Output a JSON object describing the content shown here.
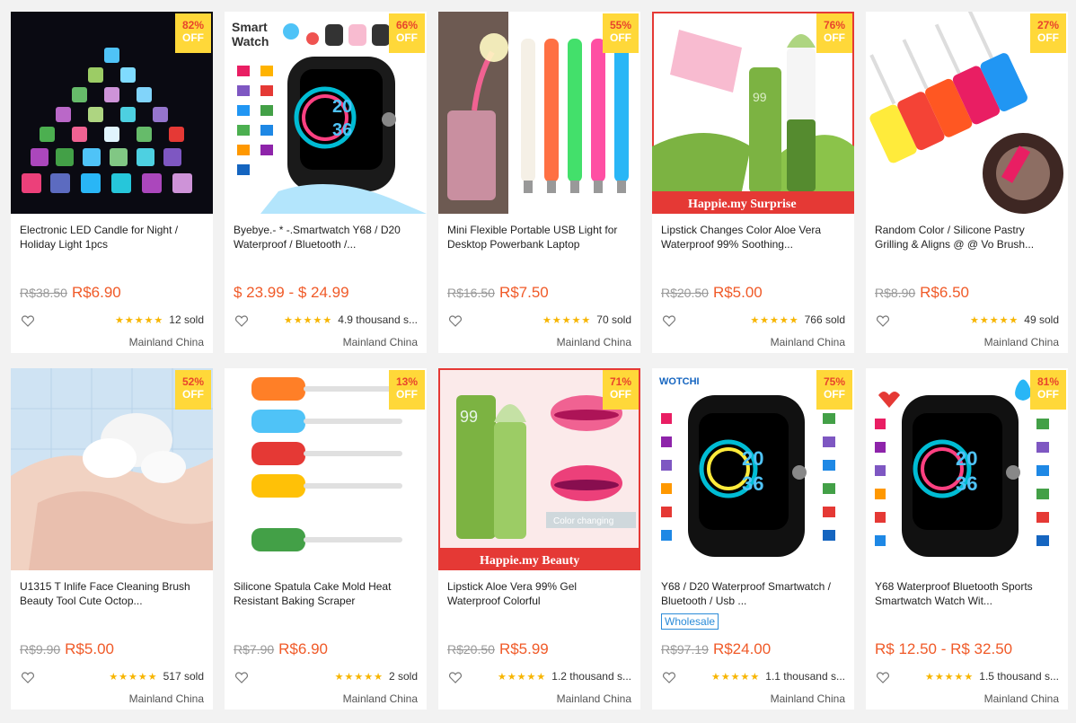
{
  "products": [
    {
      "discount": "82%",
      "off": "OFF",
      "title": "Electronic LED Candle for Night / Holiday Light 1pcs",
      "old_price": "R$38.50",
      "price": "R$6.90",
      "sold": "12 sold",
      "origin": "Mainland China",
      "image": "led-candles"
    },
    {
      "discount": "66%",
      "off": "OFF",
      "title": "Byebye.- * -.Smartwatch Y68 / D20 Waterproof / Bluetooth /...",
      "old_price": "",
      "price": "$ 23.99 - $ 24.99",
      "sold": "4.9 thousand s...",
      "origin": "Mainland China",
      "image": "smartwatch"
    },
    {
      "discount": "55%",
      "off": "OFF",
      "title": "Mini Flexible Portable USB Light for Desktop Powerbank Laptop",
      "old_price": "R$16.50",
      "price": "R$7.50",
      "sold": "70 sold",
      "origin": "Mainland China",
      "image": "usb-lights"
    },
    {
      "discount": "76%",
      "off": "OFF",
      "title": "Lipstick Changes Color Aloe Vera Waterproof 99% Soothing...",
      "old_price": "R$20.50",
      "price": "R$5.00",
      "sold": "766 sold",
      "origin": "Mainland China",
      "image": "aloe-lipstick"
    },
    {
      "discount": "27%",
      "off": "OFF",
      "title": "Random Color / Silicone Pastry Grilling & Aligns @ @ Vo Brush...",
      "old_price": "R$8.90",
      "price": "R$6.50",
      "sold": "49 sold",
      "origin": "Mainland China",
      "image": "silicone-brushes"
    },
    {
      "discount": "52%",
      "off": "OFF",
      "title": "U1315 T Inlife Face Cleaning Brush Beauty Tool Cute Octop...",
      "old_price": "R$9.90",
      "price": "R$5.00",
      "sold": "517 sold",
      "origin": "Mainland China",
      "image": "face-brush"
    },
    {
      "discount": "13%",
      "off": "OFF",
      "title": "Silicone Spatula Cake Mold Heat Resistant Baking Scraper",
      "old_price": "R$7.90",
      "price": "R$6.90",
      "sold": "2 sold",
      "origin": "Mainland China",
      "image": "spatulas"
    },
    {
      "discount": "71%",
      "off": "OFF",
      "title": "Lipstick Aloe Vera 99% Gel Waterproof Colorful",
      "old_price": "R$20.50",
      "price": "R$5.99",
      "sold": "1.2 thousand s...",
      "origin": "Mainland China",
      "image": "aloe-lipstick-lips"
    },
    {
      "discount": "75%",
      "off": "OFF",
      "title": "Y68 / D20 Waterproof Smartwatch / Bluetooth / Usb ...",
      "wholesale": "Wholesale",
      "old_price": "R$97.19",
      "price": "R$24.00",
      "sold": "1.1 thousand s...",
      "origin": "Mainland China",
      "image": "smartwatch-black"
    },
    {
      "discount": "81%",
      "off": "OFF",
      "title": "Y68 Waterproof Bluetooth Sports Smartwatch Watch Wit...",
      "old_price": "",
      "price": "R$ 12.50 - R$ 32.50",
      "sold": "1.5 thousand s...",
      "origin": "Mainland China",
      "image": "smartwatch-black-2"
    }
  ],
  "stars_text": "★★★★★",
  "colors": {
    "badge_bg": "#ffd839",
    "price": "#f05a28",
    "stars": "#f7b500",
    "wholesale": "#2b8bd8"
  }
}
